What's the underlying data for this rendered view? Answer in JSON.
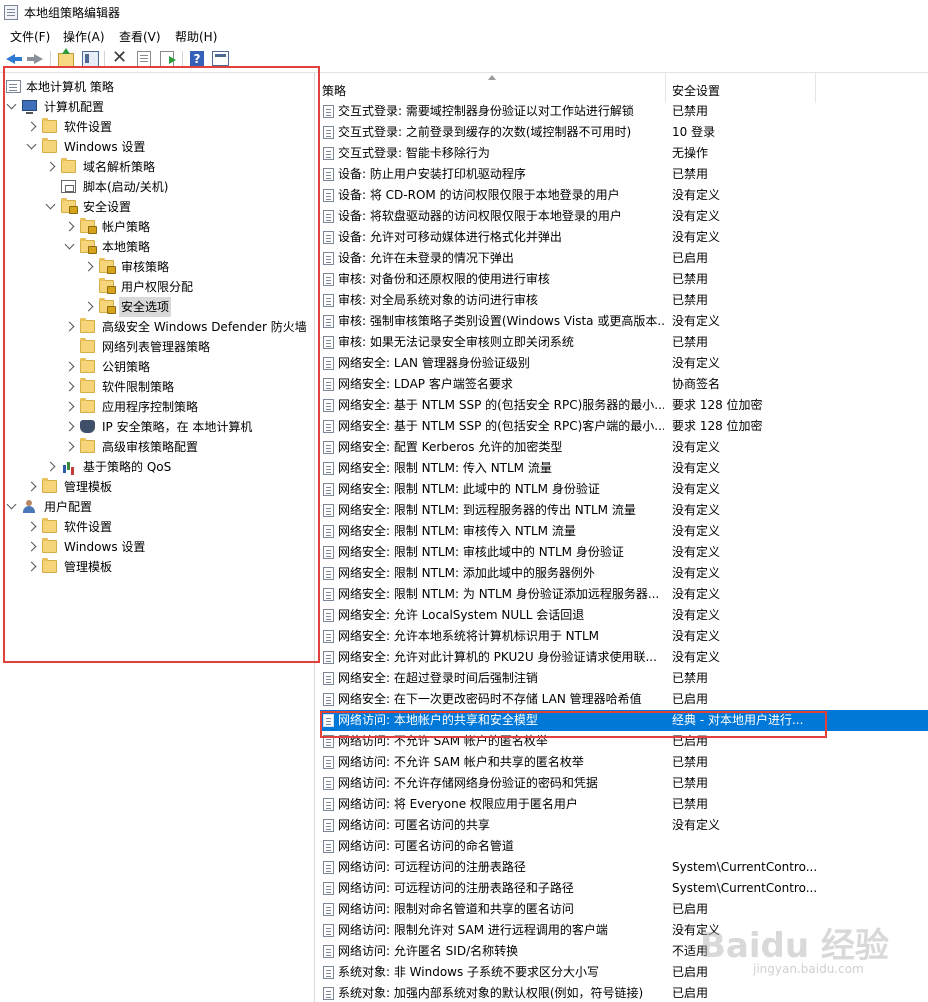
{
  "window": {
    "title": "本地组策略编辑器"
  },
  "menu": [
    "文件(F)",
    "操作(A)",
    "查看(V)",
    "帮助(H)"
  ],
  "toolbar": {
    "icons": [
      "back-arrow-icon",
      "forward-arrow-icon",
      "up-folder-icon",
      "show-tree-icon",
      "delete-icon",
      "properties-icon",
      "export-list-icon",
      "help-icon",
      "view-icon"
    ],
    "help_glyph": "?"
  },
  "tree": [
    {
      "label": "本地计算机 策略",
      "icon": "policy-icon"
    },
    {
      "label": "计算机配置",
      "icon": "computer-icon"
    },
    {
      "label": "软件设置",
      "icon": "folder-icon"
    },
    {
      "label": "Windows 设置",
      "icon": "folder-icon"
    },
    {
      "label": "域名解析策略",
      "icon": "folder-icon"
    },
    {
      "label": "脚本(启动/关机)",
      "icon": "script-icon"
    },
    {
      "label": "安全设置",
      "icon": "security-icon"
    },
    {
      "label": "帐户策略",
      "icon": "locked-folder-icon"
    },
    {
      "label": "本地策略",
      "icon": "locked-folder-icon"
    },
    {
      "label": "审核策略",
      "icon": "locked-folder-icon"
    },
    {
      "label": "用户权限分配",
      "icon": "locked-folder-icon"
    },
    {
      "label": "安全选项",
      "icon": "locked-folder-icon",
      "selected": true
    },
    {
      "label": "高级安全 Windows Defender 防火墙",
      "icon": "folder-icon"
    },
    {
      "label": "网络列表管理器策略",
      "icon": "folder-icon"
    },
    {
      "label": "公钥策略",
      "icon": "folder-icon"
    },
    {
      "label": "软件限制策略",
      "icon": "folder-icon"
    },
    {
      "label": "应用程序控制策略",
      "icon": "folder-icon"
    },
    {
      "label": "IP 安全策略，在 本地计算机",
      "icon": "shield-icon"
    },
    {
      "label": "高级审核策略配置",
      "icon": "folder-icon"
    },
    {
      "label": "基于策略的 QoS",
      "icon": "chart-icon"
    },
    {
      "label": "管理模板",
      "icon": "folder-icon"
    },
    {
      "label": "用户配置",
      "icon": "user-icon"
    },
    {
      "label": "软件设置",
      "icon": "folder-icon"
    },
    {
      "label": "Windows 设置",
      "icon": "folder-icon"
    },
    {
      "label": "管理模板",
      "icon": "folder-icon"
    }
  ],
  "list": {
    "columns": [
      "策略",
      "安全设置"
    ],
    "rows": [
      [
        "交互式登录: 需要域控制器身份验证以对工作站进行解锁",
        "已禁用"
      ],
      [
        "交互式登录: 之前登录到缓存的次数(域控制器不可用时)",
        "10 登录"
      ],
      [
        "交互式登录: 智能卡移除行为",
        "无操作"
      ],
      [
        "设备: 防止用户安装打印机驱动程序",
        "已禁用"
      ],
      [
        "设备: 将 CD-ROM 的访问权限仅限于本地登录的用户",
        "没有定义"
      ],
      [
        "设备: 将软盘驱动器的访问权限仅限于本地登录的用户",
        "没有定义"
      ],
      [
        "设备: 允许对可移动媒体进行格式化并弹出",
        "没有定义"
      ],
      [
        "设备: 允许在未登录的情况下弹出",
        "已启用"
      ],
      [
        "审核: 对备份和还原权限的使用进行审核",
        "已禁用"
      ],
      [
        "审核: 对全局系统对象的访问进行审核",
        "已禁用"
      ],
      [
        "审核: 强制审核策略子类别设置(Windows Vista 或更高版本...",
        "没有定义"
      ],
      [
        "审核: 如果无法记录安全审核则立即关闭系统",
        "已禁用"
      ],
      [
        "网络安全: LAN 管理器身份验证级别",
        "没有定义"
      ],
      [
        "网络安全: LDAP 客户端签名要求",
        "协商签名"
      ],
      [
        "网络安全: 基于 NTLM SSP 的(包括安全 RPC)服务器的最小...",
        "要求 128 位加密"
      ],
      [
        "网络安全: 基于 NTLM SSP 的(包括安全 RPC)客户端的最小...",
        "要求 128 位加密"
      ],
      [
        "网络安全: 配置 Kerberos 允许的加密类型",
        "没有定义"
      ],
      [
        "网络安全: 限制 NTLM: 传入 NTLM 流量",
        "没有定义"
      ],
      [
        "网络安全: 限制 NTLM: 此域中的 NTLM 身份验证",
        "没有定义"
      ],
      [
        "网络安全: 限制 NTLM: 到远程服务器的传出 NTLM 流量",
        "没有定义"
      ],
      [
        "网络安全: 限制 NTLM: 审核传入 NTLM 流量",
        "没有定义"
      ],
      [
        "网络安全: 限制 NTLM: 审核此域中的 NTLM 身份验证",
        "没有定义"
      ],
      [
        "网络安全: 限制 NTLM: 添加此域中的服务器例外",
        "没有定义"
      ],
      [
        "网络安全: 限制 NTLM: 为 NTLM 身份验证添加远程服务器...",
        "没有定义"
      ],
      [
        "网络安全: 允许 LocalSystem NULL 会话回退",
        "没有定义"
      ],
      [
        "网络安全: 允许本地系统将计算机标识用于 NTLM",
        "没有定义"
      ],
      [
        "网络安全: 允许对此计算机的 PKU2U 身份验证请求使用联...",
        "没有定义"
      ],
      [
        "网络安全: 在超过登录时间后强制注销",
        "已禁用"
      ],
      [
        "网络安全: 在下一次更改密码时不存储 LAN 管理器哈希值",
        "已启用"
      ],
      [
        "网络访问: 本地帐户的共享和安全模型",
        "经典 - 对本地用户进行..."
      ],
      [
        "网络访问: 不允许 SAM 帐户的匿名枚举",
        "已启用"
      ],
      [
        "网络访问: 不允许 SAM 帐户和共享的匿名枚举",
        "已禁用"
      ],
      [
        "网络访问: 不允许存储网络身份验证的密码和凭据",
        "已禁用"
      ],
      [
        "网络访问: 将 Everyone 权限应用于匿名用户",
        "已禁用"
      ],
      [
        "网络访问: 可匿名访问的共享",
        "没有定义"
      ],
      [
        "网络访问: 可匿名访问的命名管道",
        ""
      ],
      [
        "网络访问: 可远程访问的注册表路径",
        "System\\CurrentContro..."
      ],
      [
        "网络访问: 可远程访问的注册表路径和子路径",
        "System\\CurrentContro..."
      ],
      [
        "网络访问: 限制对命名管道和共享的匿名访问",
        "已启用"
      ],
      [
        "网络访问: 限制允许对 SAM 进行远程调用的客户端",
        "没有定义"
      ],
      [
        "网络访问: 允许匿名 SID/名称转换",
        "不适用"
      ],
      [
        "系统对象: 非 Windows 子系统不要求区分大小写",
        "已启用"
      ],
      [
        "系统对象: 加强内部系统对象的默认权限(例如，符号链接)",
        "已启用"
      ]
    ],
    "selected_index": 29
  },
  "watermark": {
    "text": "Baidu 经验",
    "sub": "jingyan.baidu.com"
  },
  "colors": {
    "selection": "#0078d7",
    "highlight_box": "#e0413a"
  }
}
